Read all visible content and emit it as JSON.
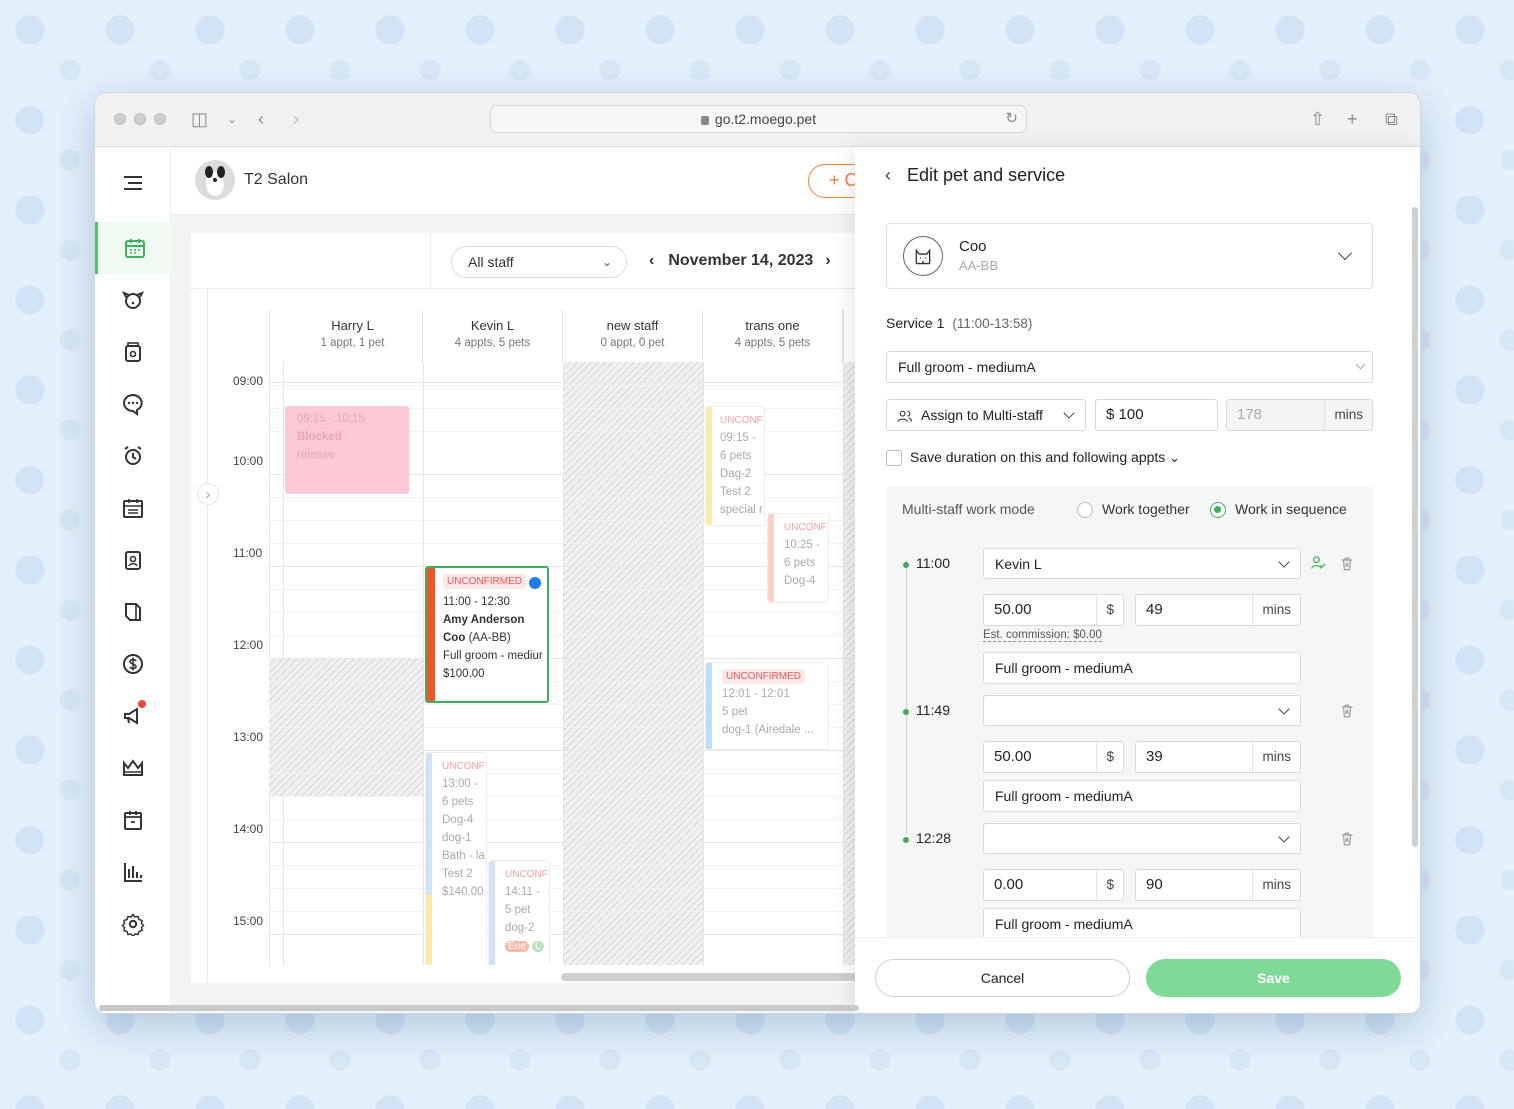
{
  "browser": {
    "url": "go.t2.moego.pet"
  },
  "header": {
    "salon_name": "T2 Salon",
    "new_button": "+ C"
  },
  "toolbar": {
    "staff_filter": "All staff",
    "date": "November 14, 2023"
  },
  "calendar": {
    "columns": [
      {
        "name": "Harry L",
        "summary": "1 appt, 1 pet"
      },
      {
        "name": "Kevin L",
        "summary": "4 appts, 5 pets"
      },
      {
        "name": "new staff",
        "summary": "0 appt, 0 pet"
      },
      {
        "name": "trans one",
        "summary": "4 appts, 5 pets"
      }
    ],
    "times": [
      "09:00",
      "10:00",
      "11:00",
      "12:00",
      "13:00",
      "14:00",
      "15:00"
    ],
    "appointments": {
      "blocked": {
        "time": "09:15 - 10:15",
        "title": "Blocked",
        "note": "release"
      },
      "main": {
        "badge": "UNCONFIRMED",
        "time": "11:00 - 12:30",
        "client": "Amy Anderson",
        "pet": "Coo",
        "pet_breed": "(AA-BB)",
        "service": "Full groom - mediur",
        "price": "$100.00"
      },
      "trans1": {
        "badge": "UNCONF",
        "time": "09:15 -",
        "pets": "6 pets",
        "pet": "Dag-2",
        "note": "Test 2",
        "extra": "special r"
      },
      "trans2": {
        "badge": "UNCONF",
        "time": "10:25 -",
        "pets": "6 pets",
        "pet": "Dog-4"
      },
      "trans3": {
        "badge": "UNCONFIRMED",
        "time": "12:01 - 12:01",
        "pets": "5 pet",
        "pet": "dog-1 (Airedale ..."
      },
      "kevin2": {
        "badge": "UNCONF",
        "time": "13:00 -",
        "pets": "6 pets",
        "pet": "Dog-4",
        "pet2": "dog-1",
        "service": "Bath - la",
        "note": "Test 2",
        "price": "$140.00"
      },
      "kevin3": {
        "badge": "UNCONF",
        "time": "14:11 -",
        "pets": "5 pet",
        "pet": "dog-2",
        "tag1": "Ene",
        "tag2": "L"
      }
    }
  },
  "panel": {
    "title": "Edit pet and service",
    "pet": {
      "name": "Coo",
      "breed": "AA-BB"
    },
    "service_label": "Service 1",
    "service_time": "(11:00-13:58)",
    "service_select": "Full groom - mediumA",
    "assign_label": "Assign to Multi-staff",
    "price": "$ 100",
    "duration": "178",
    "duration_unit": "mins",
    "save_duration_label": "Save duration on this and following appts",
    "mode_label": "Multi-staff work mode",
    "mode_together": "Work together",
    "mode_sequence": "Work in sequence",
    "staff_rows": [
      {
        "time": "11:00",
        "staff": "Kevin L",
        "price": "50.00",
        "currency": "$",
        "duration": "49",
        "unit": "mins",
        "service": "Full groom - mediumA",
        "commission": "Est. commission: $0.00"
      },
      {
        "time": "11:49",
        "staff": "",
        "price": "50.00",
        "currency": "$",
        "duration": "39",
        "unit": "mins",
        "service": "Full groom - mediumA"
      },
      {
        "time": "12:28",
        "staff": "",
        "price": "0.00",
        "currency": "$",
        "duration": "90",
        "unit": "mins",
        "service": "Full groom - mediumA"
      }
    ],
    "cancel": "Cancel",
    "save": "Save"
  },
  "colors": {
    "accent": "#4cc56c",
    "orange": "#f5813f",
    "selected_border": "#3cb05c"
  }
}
